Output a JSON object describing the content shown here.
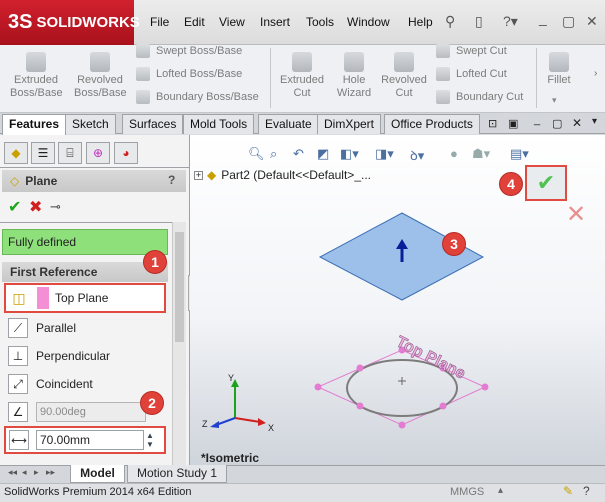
{
  "app": {
    "brand": "SOLIDWORKS"
  },
  "menu": [
    "File",
    "Edit",
    "View",
    "Insert",
    "Tools",
    "Window",
    "Help"
  ],
  "ribbon": {
    "extruded_boss": "Extruded Boss/Base",
    "revolved_boss": "Revolved Boss/Base",
    "swept_boss": "Swept Boss/Base",
    "lofted_boss": "Lofted Boss/Base",
    "boundary_boss": "Boundary Boss/Base",
    "extruded_cut": "Extruded Cut",
    "hole_wizard": "Hole Wizard",
    "revolved_cut": "Revolved Cut",
    "swept_cut": "Swept Cut",
    "lofted_cut": "Lofted Cut",
    "boundary_cut": "Boundary Cut",
    "fillet": "Fillet"
  },
  "tabs": [
    "Features",
    "Sketch",
    "Surfaces",
    "Mold Tools",
    "Evaluate",
    "DimXpert",
    "Office Products"
  ],
  "property_manager": {
    "title": "Plane",
    "help": "?",
    "status": "Fully defined",
    "section": "First Reference",
    "reference": "Top Plane",
    "options": {
      "parallel": "Parallel",
      "perpendicular": "Perpendicular",
      "coincident": "Coincident"
    },
    "angle": "90.00deg",
    "distance": "70.00mm"
  },
  "viewport": {
    "tree_label": "Part2  (Default<<Default>_...",
    "plane_label": "Top Plane",
    "view_name": "*Isometric",
    "axis_x": "X",
    "axis_y": "Y",
    "axis_z": "Z"
  },
  "callouts": [
    "1",
    "2",
    "3",
    "4"
  ],
  "bottom_tabs": [
    "Model",
    "Motion Study 1"
  ],
  "status_bar": {
    "edition": "SolidWorks Premium 2014 x64 Edition",
    "units": "MMGS"
  },
  "colors": {
    "brand": "#c8192a",
    "accent_green": "#8de07a",
    "callout": "#e0423a",
    "plane_fill": "#9cc0ea"
  }
}
